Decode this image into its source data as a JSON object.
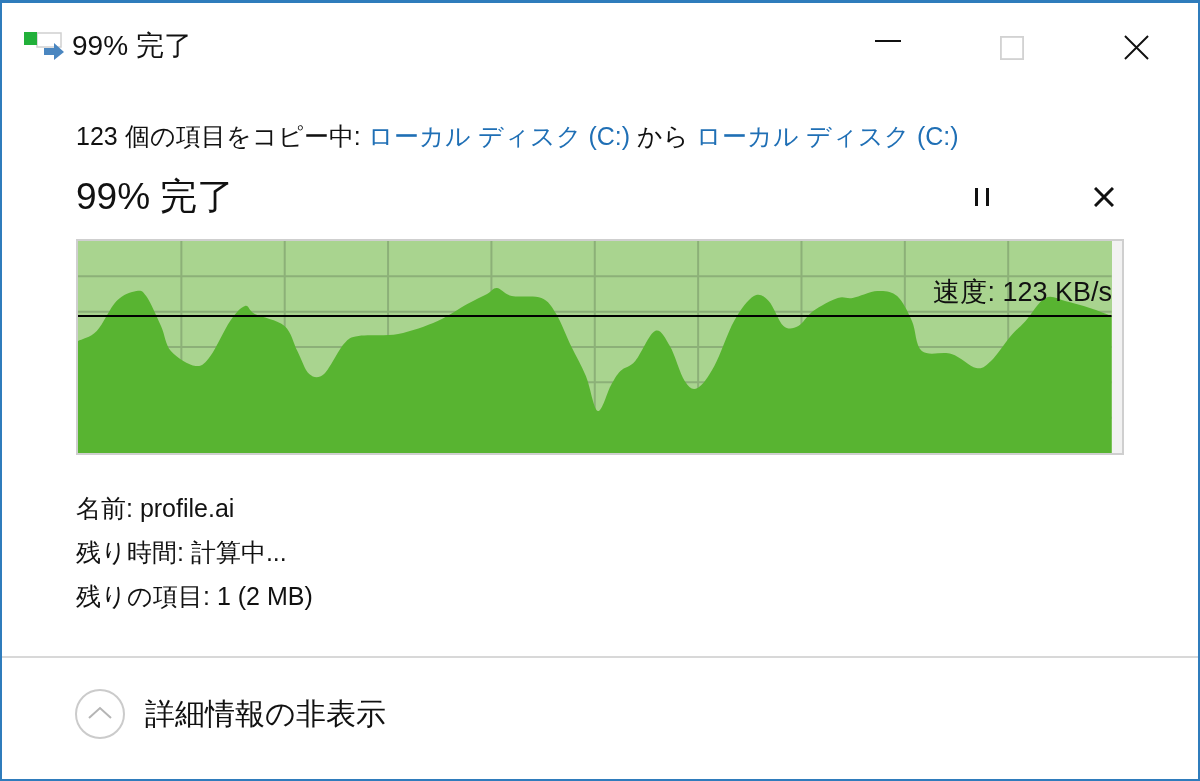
{
  "window": {
    "title": "99% 完了",
    "controls": [
      {
        "kind": "minimize",
        "disabled": false
      },
      {
        "kind": "maximize",
        "disabled": true
      },
      {
        "kind": "close",
        "disabled": false
      }
    ]
  },
  "summary": {
    "prefix": "123 個の項目をコピー中:",
    "source": "ローカル ディスク (C:)",
    "joiner": "から",
    "destination": "ローカル ディスク (C:)"
  },
  "progress": {
    "heading": "99% 完了",
    "level": 0.99,
    "speed": "速度: 123 KB/s"
  },
  "details": [
    "名前: profile.ai",
    "残り時間: 計算中...",
    "残りの項目: 1 (2 MB)"
  ],
  "toggle": {
    "label": "詳細情報の非表示",
    "expanded": true
  }
}
